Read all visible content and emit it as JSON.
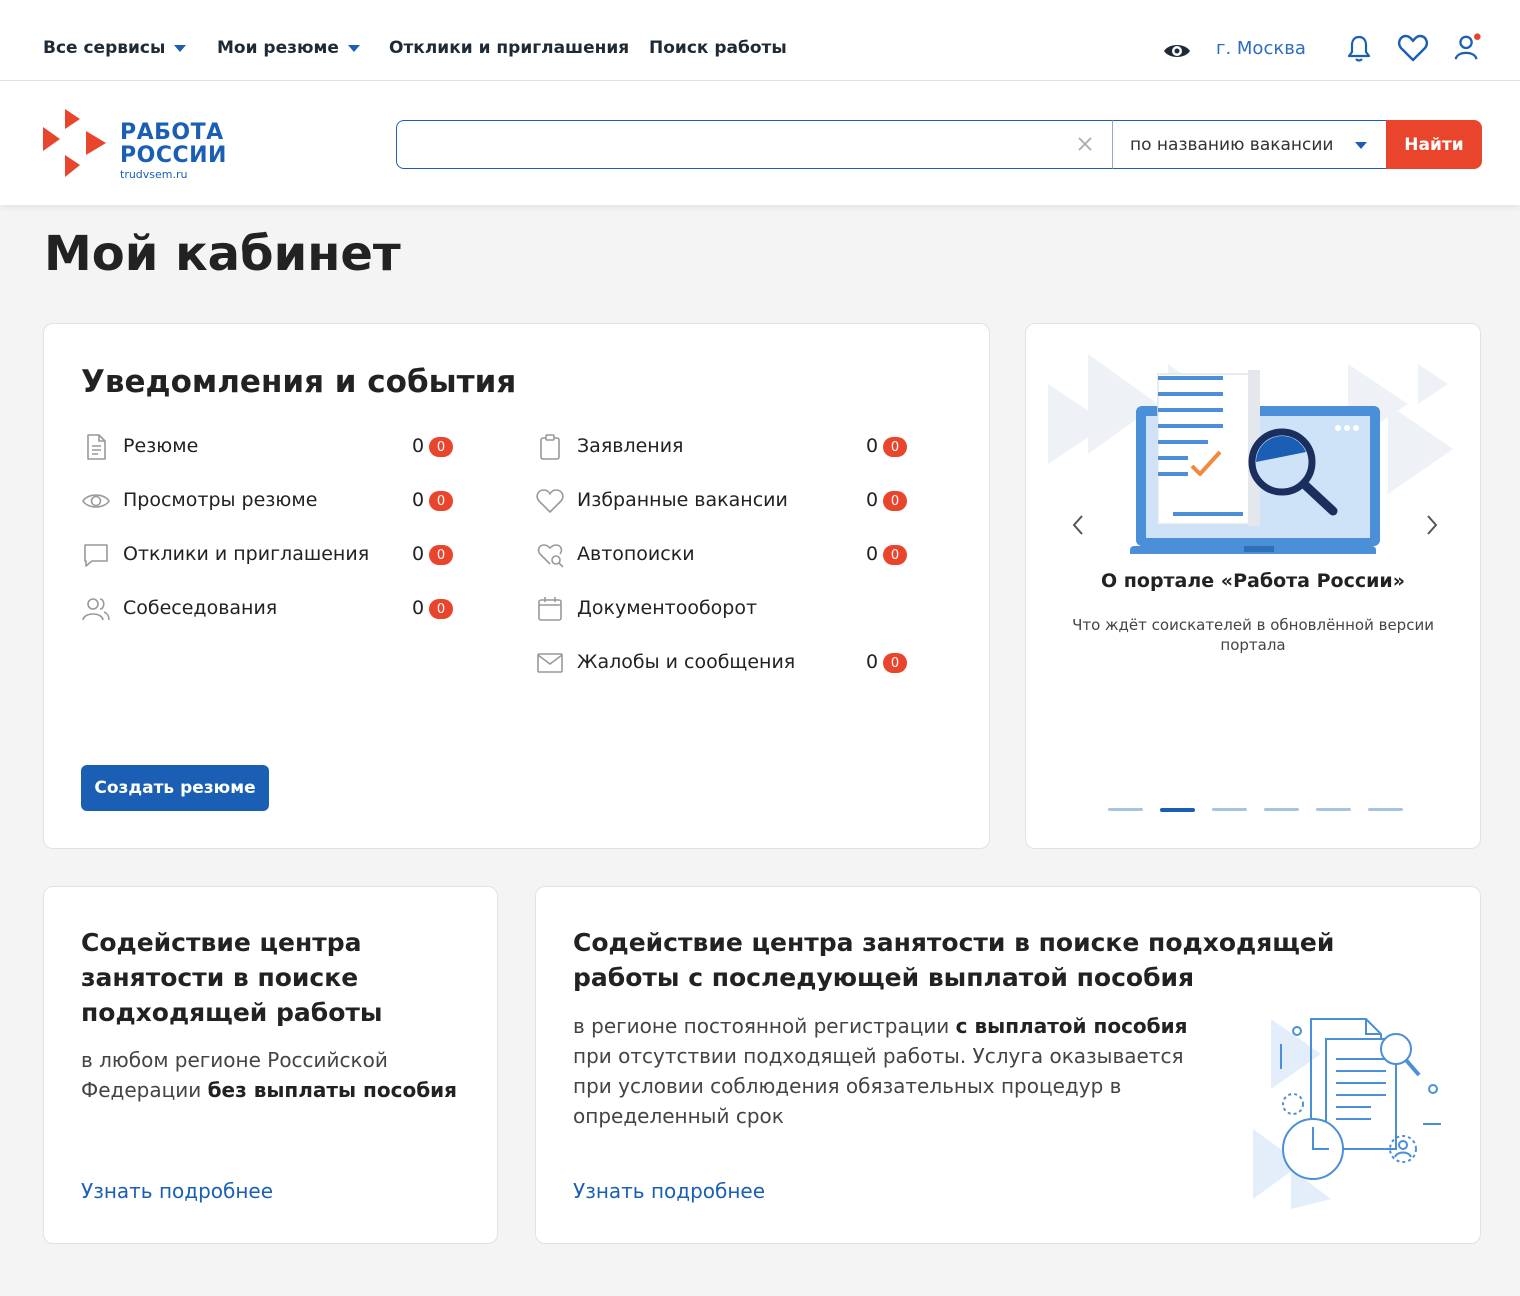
{
  "topnav": {
    "items": [
      {
        "label": "Все сервисы"
      },
      {
        "label": "Мои резюме"
      },
      {
        "label": "Отклики и приглашения"
      },
      {
        "label": "Поиск работы"
      }
    ],
    "city": "г. Москва"
  },
  "header": {
    "logo_line1": "РАБОТА",
    "logo_line2": "РОССИИ",
    "logo_sub": "trudvsem.ru",
    "search_placeholder": "",
    "search_type": "по названию вакансии",
    "search_button": "Найти"
  },
  "page_title": "Мой кабинет",
  "notifications": {
    "title": "Уведомления и события",
    "left": [
      {
        "label": "Резюме",
        "count": "0",
        "badge": "0",
        "icon": "document-icon"
      },
      {
        "label": "Просмотры резюме",
        "count": "0",
        "badge": "0",
        "icon": "eye-icon"
      },
      {
        "label": "Отклики и приглашения",
        "count": "0",
        "badge": "0",
        "icon": "chat-icon"
      },
      {
        "label": "Собеседования",
        "count": "0",
        "badge": "0",
        "icon": "users-icon"
      }
    ],
    "right": [
      {
        "label": "Заявления",
        "count": "0",
        "badge": "0",
        "icon": "clipboard-icon"
      },
      {
        "label": "Избранные вакансии",
        "count": "0",
        "badge": "0",
        "icon": "heart-icon"
      },
      {
        "label": "Автопоиски",
        "count": "0",
        "badge": "0",
        "icon": "autosearch-icon"
      },
      {
        "label": "Документооборот",
        "icon": "calendar-icon"
      },
      {
        "label": "Жалобы и сообщения",
        "count": "0",
        "badge": "0",
        "icon": "mail-icon"
      }
    ],
    "create_button": "Создать резюме"
  },
  "slider": {
    "title": "О портале «Работа России»",
    "description": "Что ждёт соискателей в обновлённой версии портала",
    "slide_count": 6,
    "active_slide": 2
  },
  "service_left": {
    "title": "Содействие центра занятости в поиске подходящей работы",
    "desc_plain": "в любом регионе Российской Федерации ",
    "desc_bold": "без выплаты пособия",
    "link": "Узнать подробнее"
  },
  "service_right": {
    "title": "Содействие центра занятости в поиске подходящей работы с последующей выплатой пособия",
    "desc_plain1": "в регионе постоянной регистрации ",
    "desc_bold": "с выплатой пособия",
    "desc_plain2": " при отсутствии подходящей работы. Услуга оказывается при условии соблюдения обязательных процедур в определенный срок",
    "link": "Узнать подробнее"
  },
  "colors": {
    "accent": "#1a5fb4",
    "brand_red": "#e8452c",
    "background": "#f4f4f5"
  }
}
